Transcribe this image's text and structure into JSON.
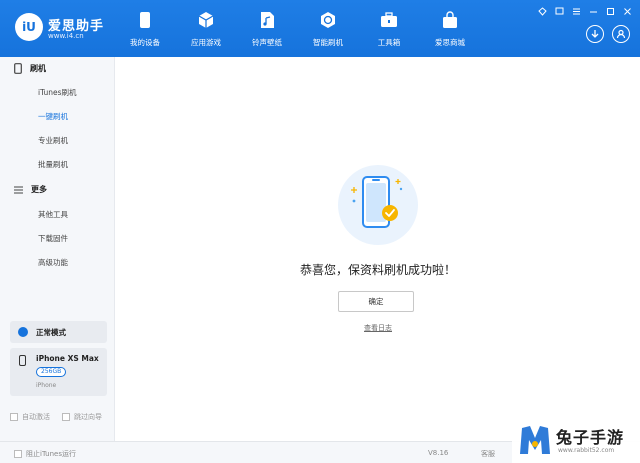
{
  "header": {
    "logo_text": "iU",
    "brand_name": "爱思助手",
    "brand_url": "www.i4.cn",
    "nav": [
      {
        "label": "我的设备",
        "icon": "phone-icon"
      },
      {
        "label": "应用游戏",
        "icon": "cube-icon"
      },
      {
        "label": "铃声壁纸",
        "icon": "music-file-icon"
      },
      {
        "label": "智能刷机",
        "icon": "refresh-icon"
      },
      {
        "label": "工具箱",
        "icon": "toolbox-icon"
      },
      {
        "label": "爱思商城",
        "icon": "shopping-bag-icon"
      }
    ]
  },
  "sidebar": {
    "flash_section": "刷机",
    "flash_items": [
      "iTunes刷机",
      "一键刷机",
      "专业刷机",
      "批量刷机"
    ],
    "more_section": "更多",
    "more_items": [
      "其他工具",
      "下载固件",
      "高级功能"
    ],
    "mode_label": "正常模式",
    "device": {
      "name": "iPhone XS Max",
      "capacity": "256GB",
      "type": "iPhone"
    },
    "auto_activate": "自动激活",
    "skip_guide": "跳过向导"
  },
  "main": {
    "success_message": "恭喜您，保资料刷机成功啦！",
    "ok_button": "确定",
    "log_link": "查看日志"
  },
  "footer": {
    "block_itunes": "阻止iTunes运行",
    "version": "V8.16",
    "item": "客服"
  },
  "watermark": {
    "title": "兔子手游",
    "url": "www.rabbit52.com"
  },
  "colors": {
    "accent": "#1673dc",
    "success": "#f7b500",
    "bg": "#f5f7fa"
  }
}
